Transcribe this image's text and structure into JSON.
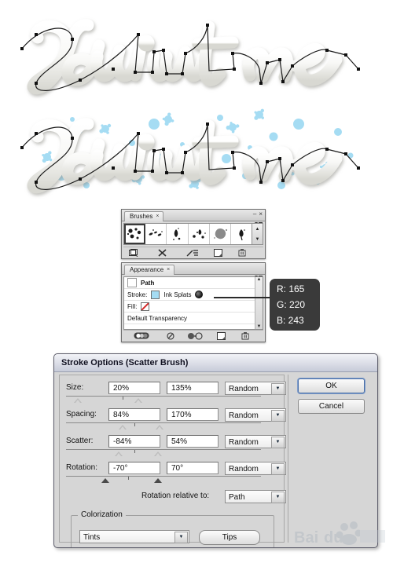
{
  "artwork": {
    "plain": {
      "name": "paint-me-plain",
      "text": "Paint me",
      "description": "embossed white handwritten lettering with vector path overlay"
    },
    "splatter": {
      "name": "paint-me-splatter",
      "text": "Paint me",
      "description": "same lettering with light blue ink splat scatter brush applied",
      "splat_color": "#a5dcf3"
    }
  },
  "brushes_panel": {
    "tab_label": "Brushes",
    "tab_close": "×",
    "minimize": "–",
    "close": "×",
    "menu_icon": "panel-menu-icon",
    "brushes": [
      {
        "name": "ink-splats-brush",
        "selected": true
      },
      {
        "name": "spatter-fine-brush",
        "selected": false
      },
      {
        "name": "drip-brush",
        "selected": false
      },
      {
        "name": "comma-splat-brush",
        "selected": false
      },
      {
        "name": "blob-brush",
        "selected": false
      },
      {
        "name": "teardrop-brush",
        "selected": false
      }
    ],
    "scroll_up": "▲",
    "scroll_down": "▼",
    "footer": [
      {
        "name": "brush-libraries-icon"
      },
      {
        "name": "remove-brush-stroke-icon"
      },
      {
        "name": "brush-options-icon"
      },
      {
        "name": "new-brush-icon"
      },
      {
        "name": "delete-brush-icon"
      }
    ]
  },
  "appearance_panel": {
    "tab_label": "Appearance",
    "tab_close": "×",
    "rows": {
      "path": "Path",
      "stroke_label": "Stroke:",
      "stroke_value": "Ink Splats",
      "fill_label": "Fill:",
      "transparency": "Default Transparency"
    },
    "stroke_swatch_color": "#a5dcf3",
    "fill_value": "None",
    "scroll_up": "▲",
    "scroll_down": "▼",
    "footer": [
      {
        "name": "new-art-has-basic-appearance-icon"
      },
      {
        "name": "clear-appearance-icon"
      },
      {
        "name": "reduce-to-basic-appearance-icon"
      },
      {
        "name": "duplicate-item-icon"
      },
      {
        "name": "delete-item-icon"
      }
    ]
  },
  "callout": {
    "r_label": "R: 165",
    "g_label": "G: 220",
    "b_label": "B: 243",
    "hex": "#a5dcf3"
  },
  "dialog": {
    "title": "Stroke Options (Scatter Brush)",
    "rows": [
      {
        "name": "size",
        "label": "Size:",
        "min_value": "20%",
        "max_value": "135%",
        "mode": "Random",
        "thumb_a_pct": 4,
        "thumb_b_pct": 35,
        "tick_pct": 29
      },
      {
        "name": "spacing",
        "label": "Spacing:",
        "min_value": "84%",
        "max_value": "170%",
        "mode": "Random",
        "thumb_a_pct": 27,
        "thumb_b_pct": 46,
        "tick_pct": 35
      },
      {
        "name": "scatter",
        "label": "Scatter:",
        "min_value": "-84%",
        "max_value": "54%",
        "mode": "Random",
        "thumb_a_pct": 25,
        "thumb_b_pct": 45,
        "tick_pct": 35
      },
      {
        "name": "rotation",
        "label": "Rotation:",
        "min_value": "-70°",
        "max_value": "70°",
        "mode": "Random",
        "thumb_a_pct": 18,
        "thumb_b_pct": 45,
        "tick_pct": 32
      }
    ],
    "rotation_relative": {
      "label": "Rotation relative to:",
      "value": "Path"
    },
    "colorization": {
      "legend": "Colorization",
      "method": "Tints",
      "tips_button": "Tips"
    },
    "buttons": {
      "ok": "OK",
      "cancel": "Cancel"
    },
    "dropdown_arrow": "▼"
  },
  "watermark": {
    "brand": "Bai",
    "brand2": "du",
    "suffix": "经验"
  }
}
